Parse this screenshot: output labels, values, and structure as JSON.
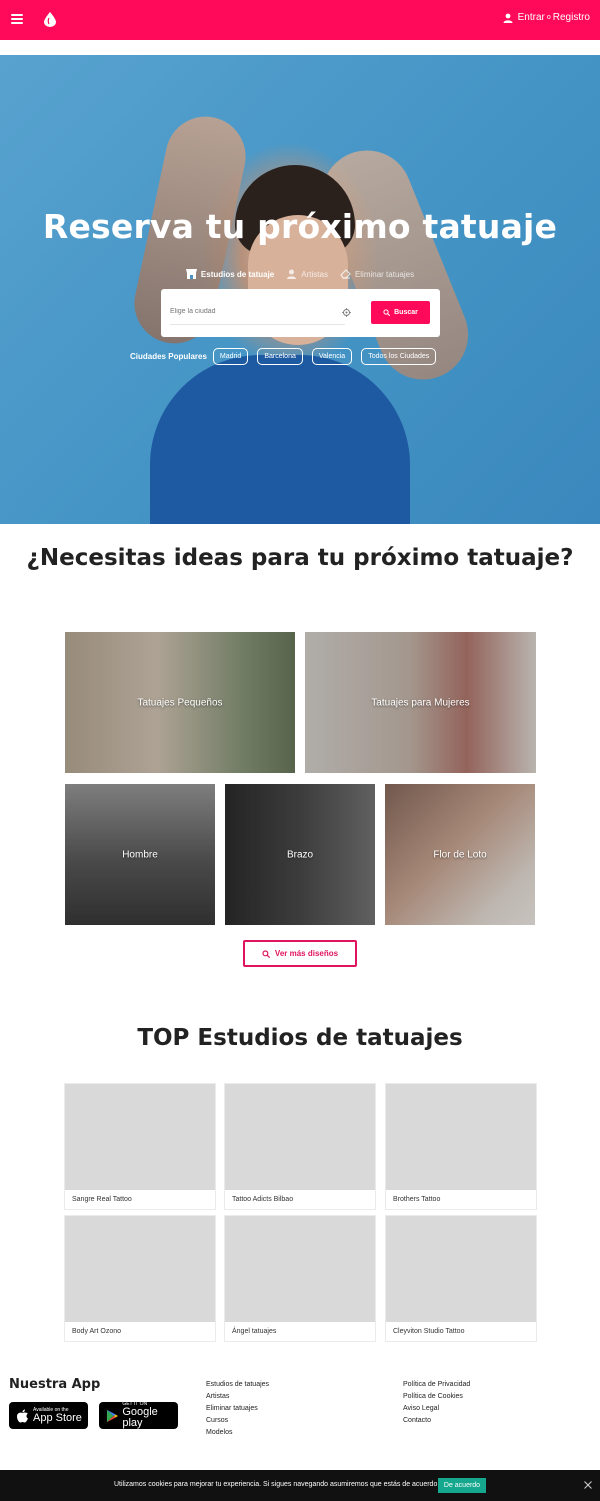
{
  "header": {
    "menu_icon": "hamburger-menu-icon",
    "logo_icon": "drop-logo-icon",
    "login_label": "Entrar",
    "login_sep": "o",
    "register_label": "Registro",
    "brand_color": "#ff0a5a"
  },
  "hero": {
    "title": "Reserva tu próximo tatuaje",
    "tabs": [
      {
        "label": "Estudios de tatuaje",
        "icon": "storefront-icon"
      },
      {
        "label": "Artistas",
        "icon": "person-icon"
      },
      {
        "label": "Eliminar tatuajes",
        "icon": "eraser-icon"
      }
    ],
    "search": {
      "placeholder": "Elige la ciudad",
      "button_label": "Buscar"
    },
    "popular_label": "Ciudades Populares",
    "cities": [
      "Madrid",
      "Barcelona",
      "Valencia",
      "Todos los Ciudades"
    ]
  },
  "ideas": {
    "title": "¿Necesitas ideas para tu próximo tatuaje?",
    "tiles": [
      "Tatuajes Pequeños",
      "Tatuajes para Mujeres",
      "Hombre",
      "Brazo",
      "Flor de Loto"
    ],
    "more_label": "Ver más diseños"
  },
  "studios": {
    "title": "TOP Estudios de tatuajes",
    "items": [
      "Sangre Real Tattoo",
      "Tattoo Adicts Bilbao",
      "Brothers Tattoo",
      "Body Art Ozono",
      "Ángel tatuajes",
      "Cleyviton Studio Tattoo"
    ]
  },
  "footer": {
    "app_title": "Nuestra App",
    "appstore_small": "Available on the",
    "appstore_big": "App Store",
    "gplay_small": "GET IT ON",
    "gplay_big": "Google play",
    "col1": [
      "Estudios de tatuajes",
      "Artistas",
      "Eliminar tatuajes",
      "Cursos",
      "Modelos"
    ],
    "col2": [
      "Política de Privacidad",
      "Política de Cookies",
      "Aviso Legal",
      "Contacto"
    ]
  },
  "cookie": {
    "text": "Utilizamos cookies para mejorar tu experiencia. Si sigues navegando asumiremos que estás de acuerdo.",
    "accept_label": "De acuerdo",
    "accent_color": "#16a88e"
  }
}
